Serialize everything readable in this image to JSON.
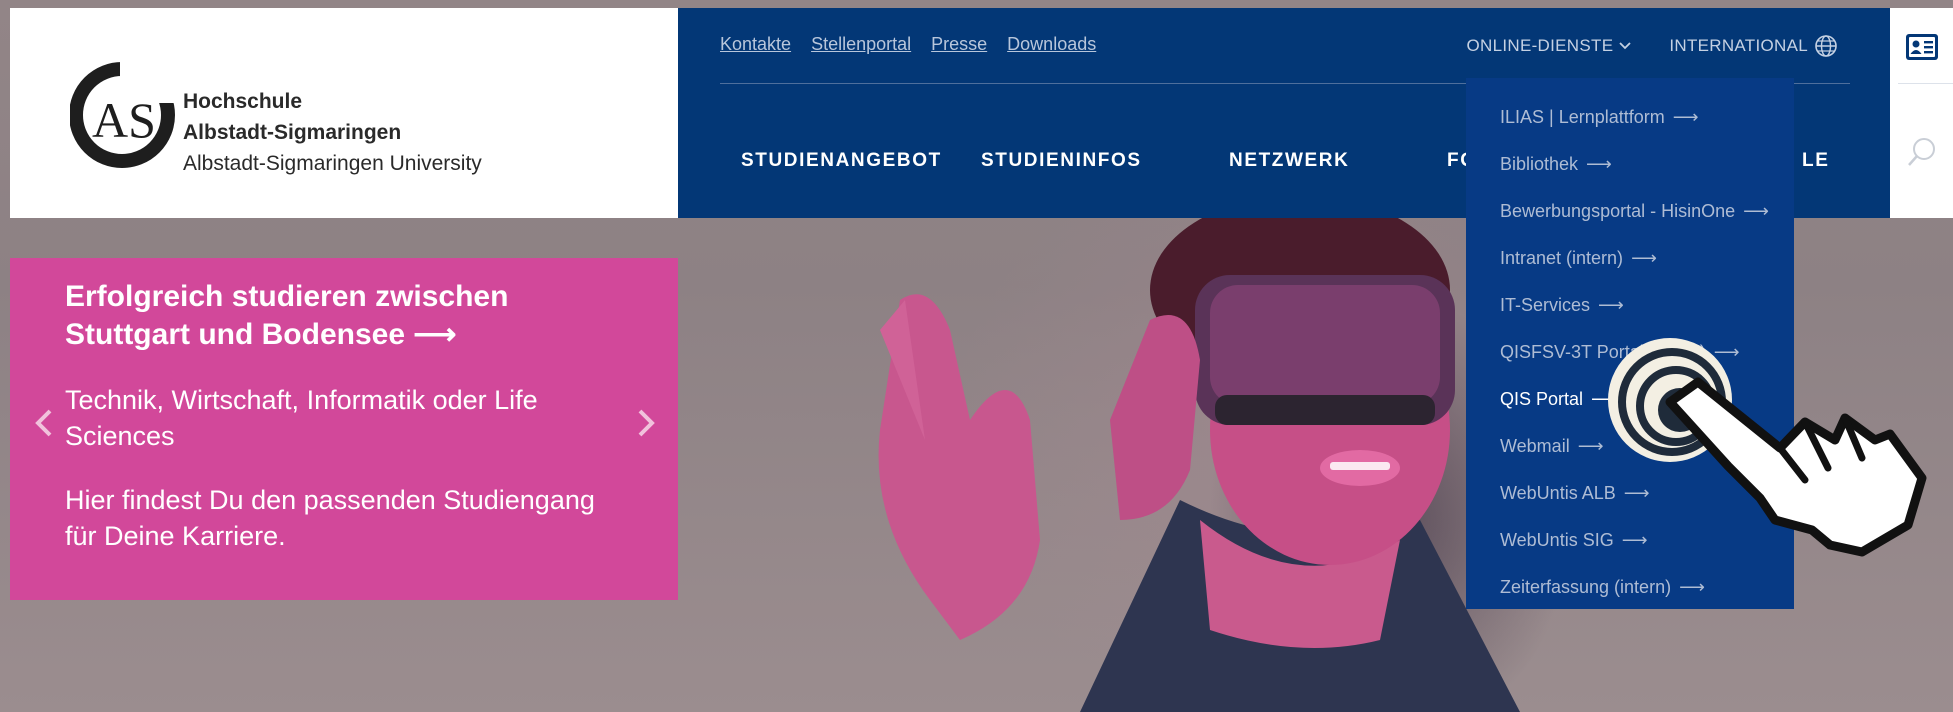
{
  "logo": {
    "line1": "Hochschule",
    "line2": "Albstadt-Sigmaringen",
    "line3": "Albstadt-Sigmaringen University",
    "mark_text": "AS"
  },
  "toplinks": [
    "Kontakte",
    "Stellenportal",
    "Presse",
    "Downloads"
  ],
  "topright": {
    "online": "ONLINE-DIENSTE",
    "international": "INTERNATIONAL"
  },
  "mainnav": [
    "STUDIENANGEBOT",
    "STUDIENINFOS",
    "NETZWERK",
    "FO",
    "LE"
  ],
  "dropdown": [
    {
      "label": "ILIAS | Lernplattform"
    },
    {
      "label": "Bibliothek"
    },
    {
      "label": "Bewerbungsportal - HisinOne"
    },
    {
      "label": "Intranet (intern)"
    },
    {
      "label": "IT-Services"
    },
    {
      "label": "QISFSV-3T Portal (intern)"
    },
    {
      "label": "QIS Portal"
    },
    {
      "label": "Webmail"
    },
    {
      "label": "WebUntis ALB"
    },
    {
      "label": "WebUntis SIG"
    },
    {
      "label": "Zeiterfassung (intern)"
    }
  ],
  "hero": {
    "heading": "Erfolgreich studieren zwischen Stuttgart und Bodensee",
    "text1": "Technik, Wirtschaft, Informatik oder Life Sciences",
    "text2": "Hier findest Du den passenden Studiengang für Deine Karriere."
  },
  "colors": {
    "navy": "#033776",
    "dropdown": "#073a85",
    "pink": "#d2489a"
  }
}
